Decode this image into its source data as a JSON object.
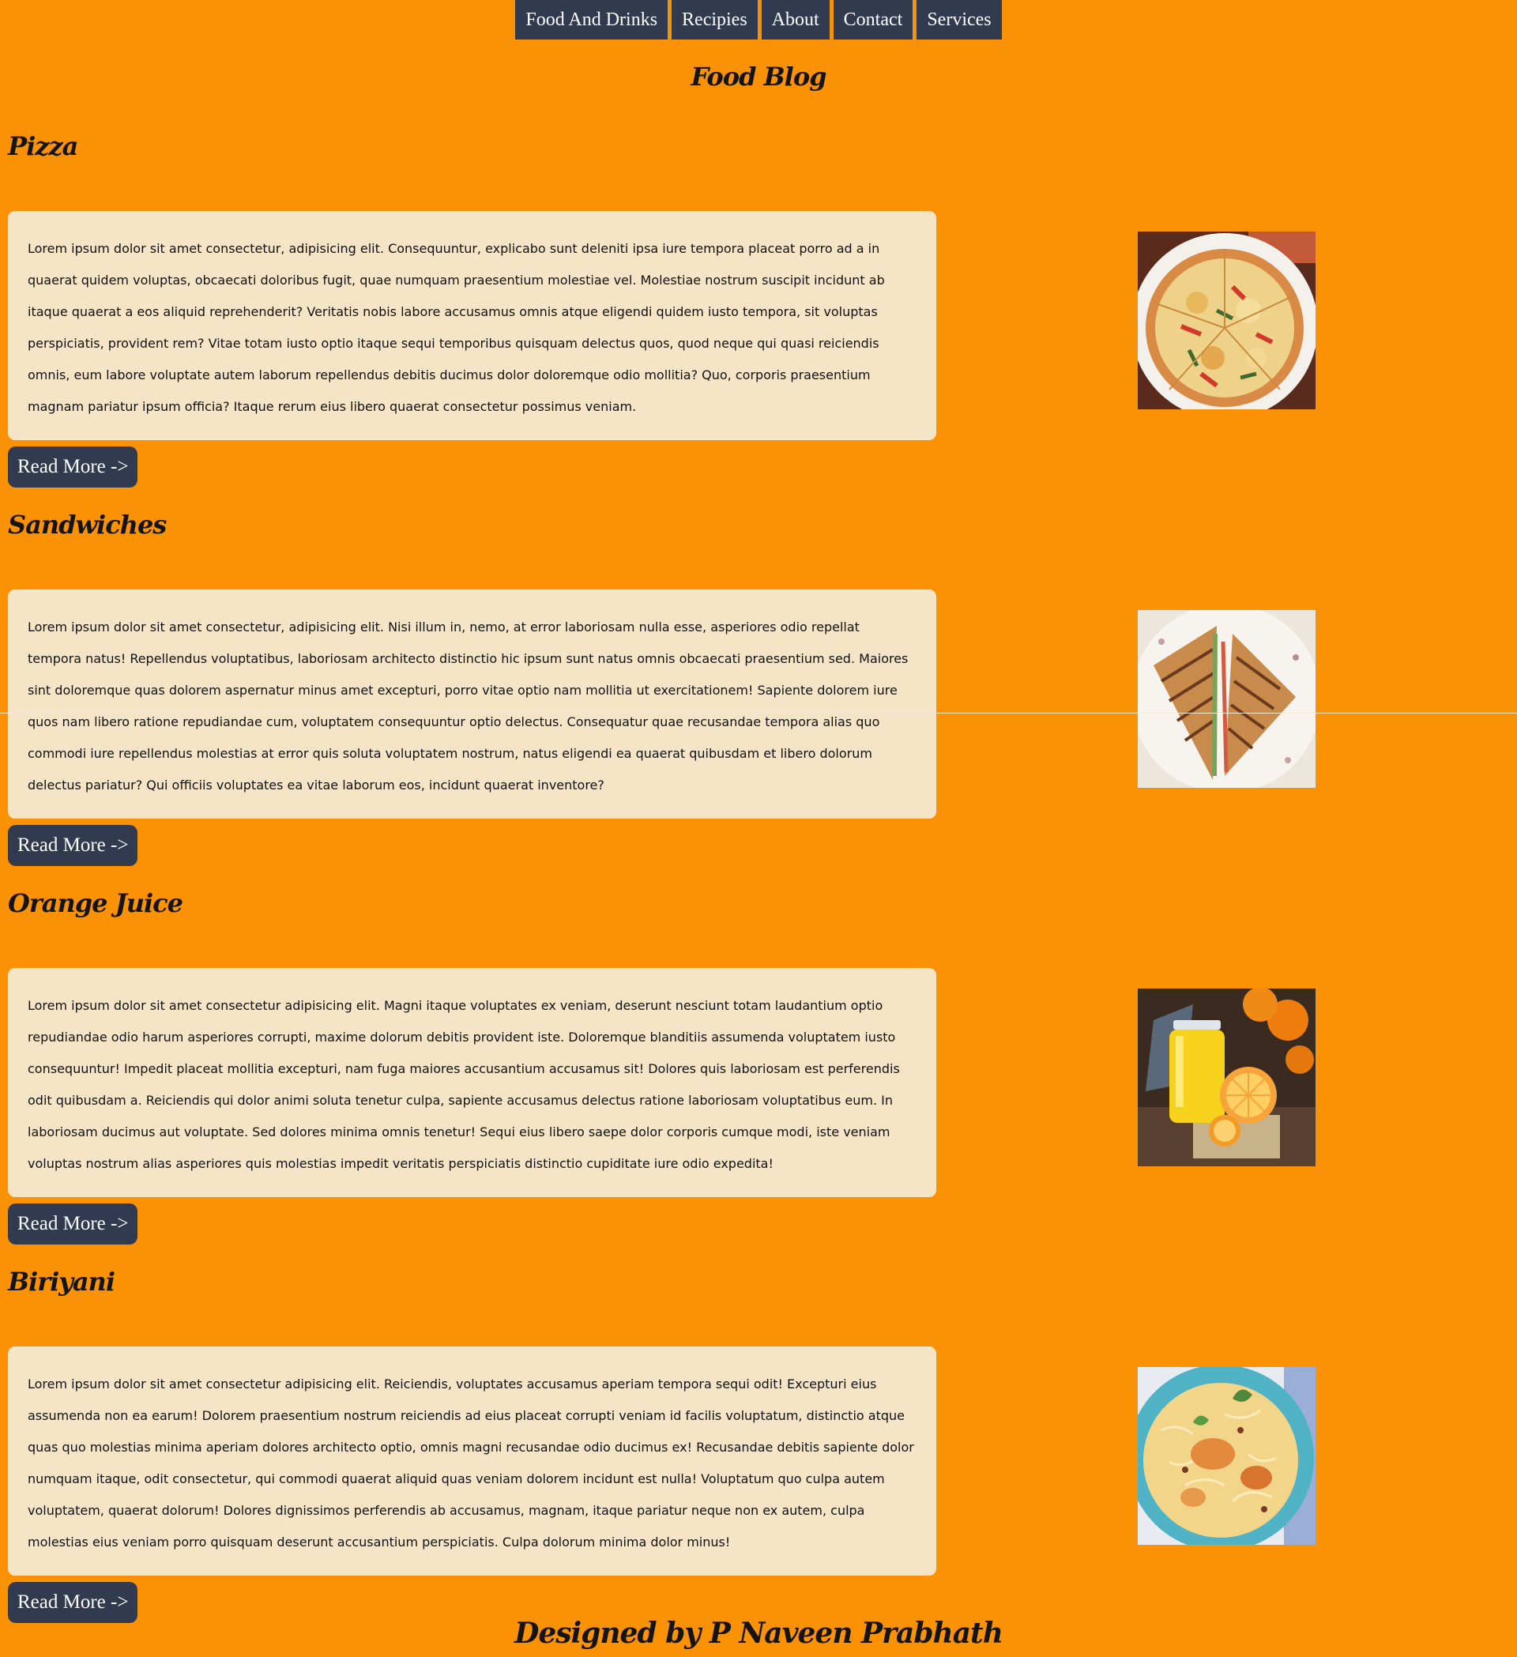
{
  "nav": {
    "items": [
      "Food And Drinks",
      "Recipies",
      "About",
      "Contact",
      "Services"
    ]
  },
  "page": {
    "title": "Food Blog"
  },
  "posts": [
    {
      "title": "Pizza",
      "body": "Lorem ipsum dolor sit amet consectetur, adipisicing elit. Consequuntur, explicabo sunt deleniti ipsa iure tempora placeat porro ad a in quaerat quidem voluptas, obcaecati doloribus fugit, quae numquam praesentium molestiae vel. Molestiae nostrum suscipit incidunt ab itaque quaerat a eos aliquid reprehenderit? Veritatis nobis labore accusamus omnis atque eligendi quidem iusto tempora, sit voluptas perspiciatis, provident rem? Vitae totam iusto optio itaque sequi temporibus quisquam delectus quos, quod neque qui quasi reiciendis omnis, eum labore voluptate autem laborum repellendus debitis ducimus dolor doloremque odio mollitia? Quo, corporis praesentium magnam pariatur ipsum officia? Itaque rerum eius libero quaerat consectetur possimus veniam.",
      "button": "Read More ->",
      "image_icon": "pizza-image"
    },
    {
      "title": "Sandwiches",
      "body": "Lorem ipsum dolor sit amet consectetur, adipisicing elit. Nisi illum in, nemo, at error laboriosam nulla esse, asperiores odio repellat tempora natus! Repellendus voluptatibus, laboriosam architecto distinctio hic ipsum sunt natus omnis obcaecati praesentium sed. Maiores sint doloremque quas dolorem aspernatur minus amet excepturi, porro vitae optio nam mollitia ut exercitationem! Sapiente dolorem iure quos nam libero ratione repudiandae cum, voluptatem consequuntur optio delectus. Consequatur quae recusandae tempora alias quo commodi iure repellendus molestias at error quis soluta voluptatem nostrum, natus eligendi ea quaerat quibusdam et libero dolorum delectus pariatur? Qui officiis voluptates ea vitae laborum eos, incidunt quaerat inventore?",
      "button": "Read More ->",
      "image_icon": "sandwich-image"
    },
    {
      "title": "Orange Juice",
      "body": "Lorem ipsum dolor sit amet consectetur adipisicing elit. Magni itaque voluptates ex veniam, deserunt nesciunt totam laudantium optio repudiandae odio harum asperiores corrupti, maxime dolorum debitis provident iste. Doloremque blanditiis assumenda voluptatem iusto consequuntur! Impedit placeat mollitia excepturi, nam fuga maiores accusantium accusamus sit! Dolores quis laboriosam est perferendis odit quibusdam a. Reiciendis qui dolor animi soluta tenetur culpa, sapiente accusamus delectus ratione laboriosam voluptatibus eum. In laboriosam ducimus aut voluptate. Sed dolores minima omnis tenetur! Sequi eius libero saepe dolor corporis cumque modi, iste veniam voluptas nostrum alias asperiores quis molestias impedit veritatis perspiciatis distinctio cupiditate iure odio expedita!",
      "button": "Read More ->",
      "image_icon": "orange-juice-image"
    },
    {
      "title": "Biriyani",
      "body": "Lorem ipsum dolor sit amet consectetur adipisicing elit. Reiciendis, voluptates accusamus aperiam tempora sequi odit! Excepturi eius assumenda non ea earum! Dolorem praesentium nostrum reiciendis ad eius placeat corrupti veniam id facilis voluptatum, distinctio atque quas quo molestias minima aperiam dolores architecto optio, omnis magni recusandae odio ducimus ex! Recusandae debitis sapiente dolor numquam itaque, odit consectetur, qui commodi quaerat aliquid quas veniam dolorem incidunt est nulla! Voluptatum quo culpa autem voluptatem, quaerat dolorum! Dolores dignissimos perferendis ab accusamus, magnam, itaque pariatur neque non ex autem, culpa molestias eius veniam porro quisquam deserunt accusantium perspiciatis. Culpa dolorum minima dolor minus!",
      "button": "Read More ->",
      "image_icon": "biriyani-image"
    }
  ],
  "footer": {
    "text": "Designed by P Naveen Prabhath"
  },
  "colors": {
    "background": "#fb9104",
    "nav_button": "#313a4f",
    "card": "#f5e4c6"
  }
}
